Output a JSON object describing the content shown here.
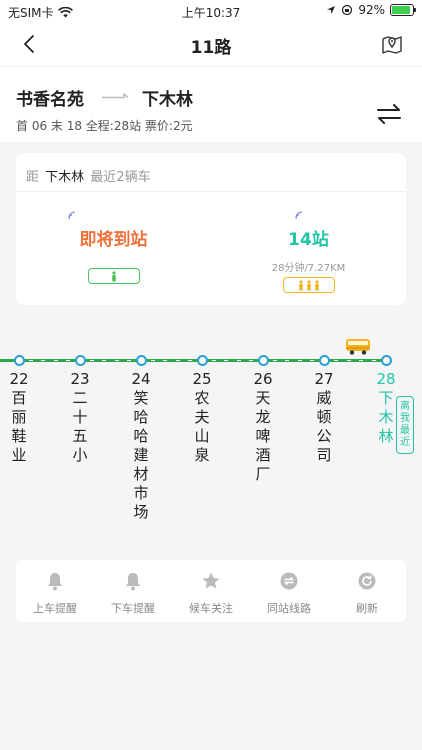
{
  "status_bar": {
    "carrier": "无SIM卡",
    "time": "上午10:37",
    "battery": "92%",
    "battery_level": 0.92
  },
  "nav": {
    "title": "11路"
  },
  "route": {
    "from": "书香名苑",
    "to": "下木林",
    "info": "首 06 末 18 全程:28站  票价:2元"
  },
  "arrival_card": {
    "prefix": "距",
    "stop": "下木林",
    "suffix": "最近2辆车",
    "buses": [
      {
        "status": "即将到站",
        "detail": ""
      },
      {
        "status": "14站",
        "detail": "28分钟/7.27KM"
      }
    ]
  },
  "stops": [
    {
      "num": "22",
      "name": [
        "百",
        "丽",
        "鞋",
        "业"
      ]
    },
    {
      "num": "23",
      "name": [
        "二",
        "十",
        "五",
        "小"
      ]
    },
    {
      "num": "24",
      "name": [
        "笑",
        "哈",
        "哈",
        "建",
        "材",
        "市",
        "场"
      ]
    },
    {
      "num": "25",
      "name": [
        "农",
        "夫",
        "山",
        "泉"
      ]
    },
    {
      "num": "26",
      "name": [
        "天",
        "龙",
        "啤",
        "酒",
        "厂"
      ]
    },
    {
      "num": "27",
      "name": [
        "威",
        "顿",
        "公",
        "司"
      ]
    },
    {
      "num": "28",
      "name": [
        "下",
        "木",
        "林"
      ]
    }
  ],
  "near_tag": [
    "离",
    "我",
    "最",
    "近"
  ],
  "toolbar": [
    {
      "label": "上车提醒",
      "icon": "bell-icon"
    },
    {
      "label": "下车提醒",
      "icon": "bell-icon"
    },
    {
      "label": "候车关注",
      "icon": "star-icon"
    },
    {
      "label": "同站线路",
      "icon": "transfer-icon"
    },
    {
      "label": "刷新",
      "icon": "refresh-icon"
    }
  ],
  "colors": {
    "arriving": "#f0723a",
    "teal": "#22c4a8",
    "line_green": "#2aa84a",
    "stop_blue": "#2aa0d8",
    "bus_yellow": "#f2b51e"
  }
}
